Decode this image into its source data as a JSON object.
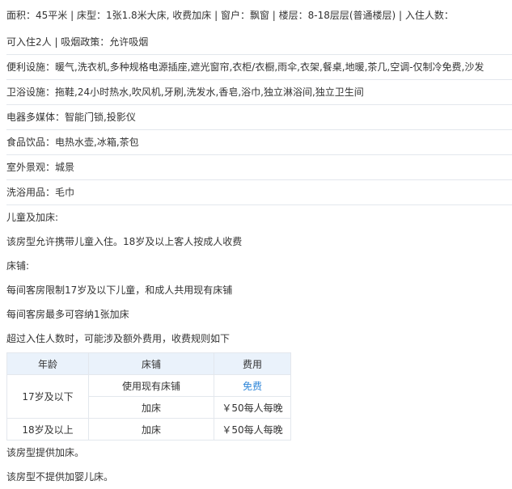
{
  "room": {
    "line1": "面积：45平米 | 床型：1张1.8米大床, 收费加床 | 窗户：飘窗 | 楼层：8-18层层(普通楼层) | 入住人数：",
    "line2": "可入住2人 | 吸烟政策：允许吸烟"
  },
  "facilities": [
    {
      "label": "便利设施：",
      "value": "暖气,洗衣机,多种规格电源插座,遮光窗帘,衣柜/衣橱,雨伞,衣架,餐桌,地暖,茶几,空调-仅制冷免费,沙发"
    },
    {
      "label": "卫浴设施：",
      "value": "拖鞋,24小时热水,吹风机,牙刷,洗发水,香皂,浴巾,独立淋浴间,独立卫生间"
    },
    {
      "label": "电器多媒体：",
      "value": "智能门锁,投影仪"
    },
    {
      "label": "食品饮品：",
      "value": "电热水壶,冰箱,茶包"
    },
    {
      "label": "室外景观：",
      "value": "城景"
    },
    {
      "label": "洗浴用品：",
      "value": "毛巾"
    }
  ],
  "policy": {
    "children_title": "儿童及加床:",
    "children_text": "该房型允许携带儿童入住。18岁及以上客人按成人收费",
    "bed_title": "床铺:",
    "bed_text1": "每间客房限制17岁及以下儿童，和成人共用现有床铺",
    "bed_text2": "每间客房最多可容纳1张加床",
    "fee_intro": "超过入住人数时，可能涉及额外费用，收费规则如下"
  },
  "fee_table": {
    "headers": [
      "年龄",
      "床铺",
      "费用"
    ],
    "group1_age": "17岁及以下",
    "rows": [
      {
        "bed": "使用现有床铺",
        "fee": "免费"
      },
      {
        "bed": "加床",
        "fee": "￥50每人每晚"
      }
    ],
    "row3": {
      "age": "18岁及以上",
      "bed": "加床",
      "fee": "￥50每人每晚"
    }
  },
  "notes": {
    "extra_bed": "该房型提供加床。",
    "no_crib": "该房型不提供加婴儿床。"
  },
  "colors": {
    "free_text": "#2f86d8",
    "table_header_bg": "#eaf2fb",
    "divider": "#e3e7ed"
  }
}
